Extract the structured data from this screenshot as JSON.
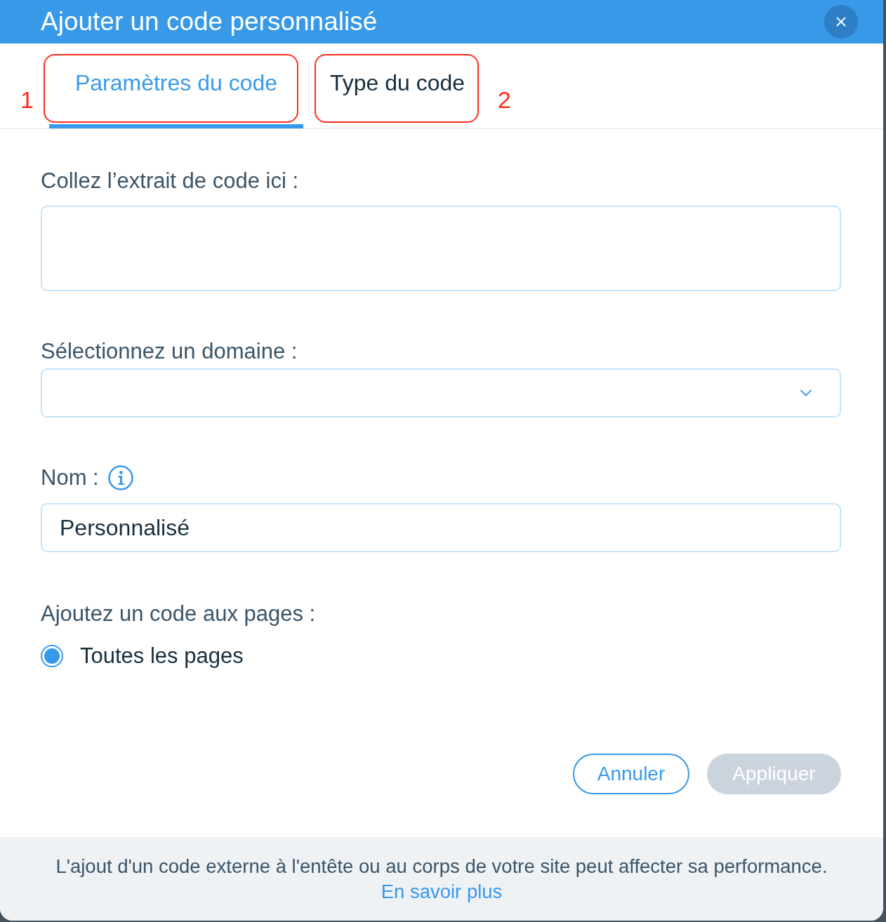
{
  "dialog": {
    "title": "Ajouter un code personnalisé"
  },
  "tabs": [
    {
      "label": "Paramètres du code",
      "selected": true,
      "annotation": "1"
    },
    {
      "label": "Type du code",
      "selected": false,
      "annotation": "2"
    }
  ],
  "fields": [
    {
      "kind": "textarea",
      "label": "Collez l’extrait de code ici :"
    },
    {
      "kind": "select",
      "label": "Sélectionnez un domaine :"
    },
    {
      "kind": "text",
      "label": "Nom :",
      "info": true,
      "value": "Personnalisé"
    }
  ],
  "pages_option": {
    "label": "Ajoutez un code aux pages :",
    "options": [
      {
        "label": "Toutes les pages",
        "selected": true
      }
    ]
  },
  "buttons": [
    {
      "label": "Annuler",
      "kind": "secondary",
      "disabled": false
    },
    {
      "label": "Appliquer",
      "kind": "primary",
      "disabled": true
    }
  ],
  "footer": {
    "text": "L'ajout d'un code externe à l'entête ou au corps de votre site peut affecter sa performance.",
    "link": "En savoir plus"
  }
}
